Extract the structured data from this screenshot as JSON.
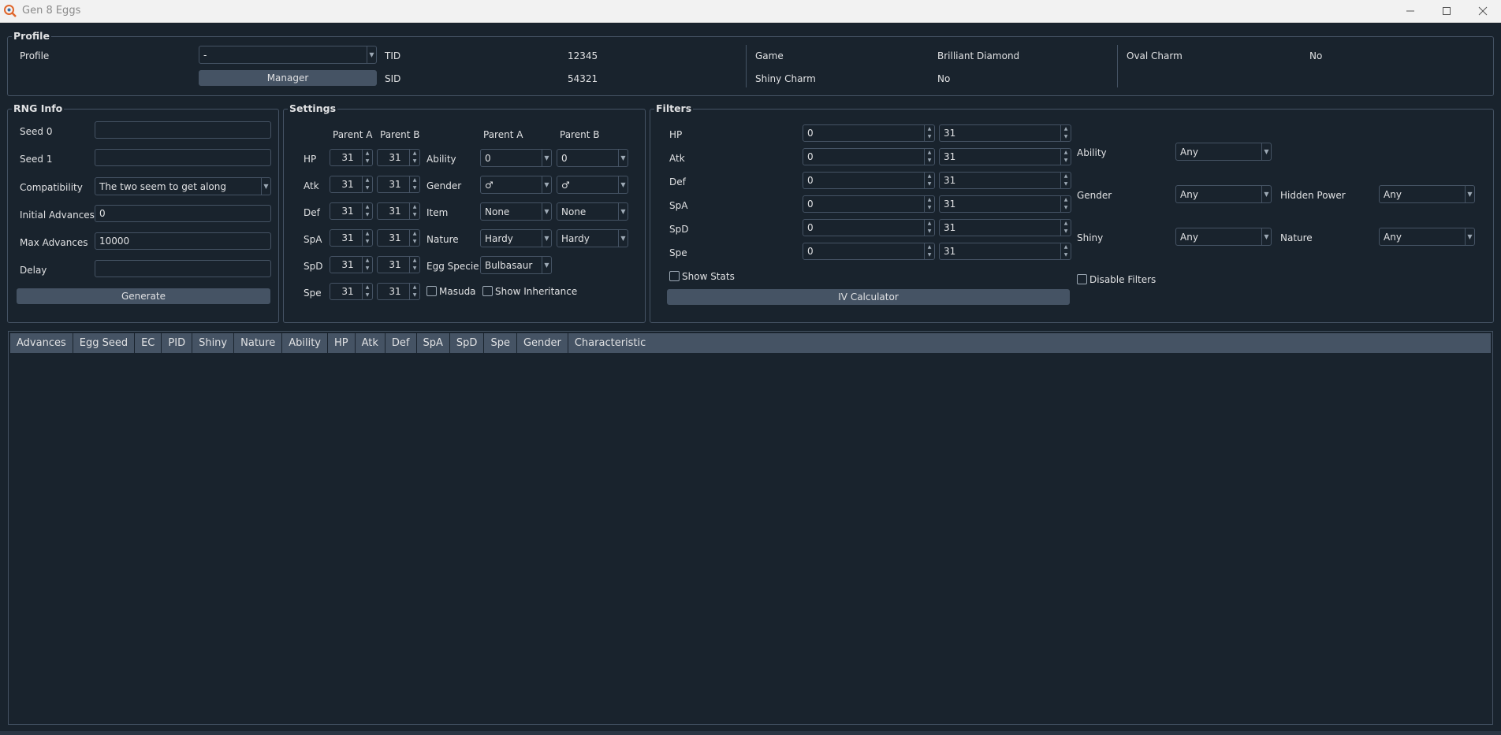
{
  "window": {
    "title": "Gen 8 Eggs"
  },
  "profile": {
    "group_title": "Profile",
    "profile_label": "Profile",
    "profile_value": "-",
    "manager_button": "Manager",
    "tid_label": "TID",
    "tid_value": "12345",
    "sid_label": "SID",
    "sid_value": "54321",
    "game_label": "Game",
    "game_value": "Brilliant Diamond",
    "shiny_charm_label": "Shiny Charm",
    "shiny_charm_value": "No",
    "oval_charm_label": "Oval Charm",
    "oval_charm_value": "No"
  },
  "rng": {
    "group_title": "RNG Info",
    "seed0_label": "Seed 0",
    "seed0_value": "",
    "seed1_label": "Seed 1",
    "seed1_value": "",
    "compat_label": "Compatibility",
    "compat_value": "The two seem to get along",
    "initial_label": "Initial Advances",
    "initial_value": "0",
    "max_label": "Max Advances",
    "max_value": "10000",
    "delay_label": "Delay",
    "delay_value": "",
    "generate_button": "Generate"
  },
  "settings": {
    "group_title": "Settings",
    "parent_a": "Parent A",
    "parent_b": "Parent B",
    "ivs": [
      {
        "stat": "HP",
        "a": "31",
        "b": "31"
      },
      {
        "stat": "Atk",
        "a": "31",
        "b": "31"
      },
      {
        "stat": "Def",
        "a": "31",
        "b": "31"
      },
      {
        "stat": "SpA",
        "a": "31",
        "b": "31"
      },
      {
        "stat": "SpD",
        "a": "31",
        "b": "31"
      },
      {
        "stat": "Spe",
        "a": "31",
        "b": "31"
      }
    ],
    "ability_label": "Ability",
    "ability_a": "0",
    "ability_b": "0",
    "gender_label": "Gender",
    "gender_a": "♂",
    "gender_b": "♂",
    "item_label": "Item",
    "item_a": "None",
    "item_b": "None",
    "nature_label": "Nature",
    "nature_a": "Hardy",
    "nature_b": "Hardy",
    "egg_specie_label": "Egg Specie",
    "egg_specie_value": "Bulbasaur",
    "masuda_label": "Masuda",
    "show_inheritance_label": "Show Inheritance"
  },
  "filters": {
    "group_title": "Filters",
    "ivs": [
      {
        "stat": "HP",
        "min": "0",
        "max": "31"
      },
      {
        "stat": "Atk",
        "min": "0",
        "max": "31"
      },
      {
        "stat": "Def",
        "min": "0",
        "max": "31"
      },
      {
        "stat": "SpA",
        "min": "0",
        "max": "31"
      },
      {
        "stat": "SpD",
        "min": "0",
        "max": "31"
      },
      {
        "stat": "Spe",
        "min": "0",
        "max": "31"
      }
    ],
    "show_stats_label": "Show Stats",
    "iv_calculator_button": "IV Calculator",
    "ability_label": "Ability",
    "ability_value": "Any",
    "gender_label": "Gender",
    "gender_value": "Any",
    "shiny_label": "Shiny",
    "shiny_value": "Any",
    "hidden_power_label": "Hidden Power",
    "hidden_power_value": "Any",
    "nature_label": "Nature",
    "nature_value": "Any",
    "disable_filters_label": "Disable Filters"
  },
  "table": {
    "columns": [
      "Advances",
      "Egg Seed",
      "EC",
      "PID",
      "Shiny",
      "Nature",
      "Ability",
      "HP",
      "Atk",
      "Def",
      "SpA",
      "SpD",
      "Spe",
      "Gender",
      "Characteristic"
    ]
  }
}
